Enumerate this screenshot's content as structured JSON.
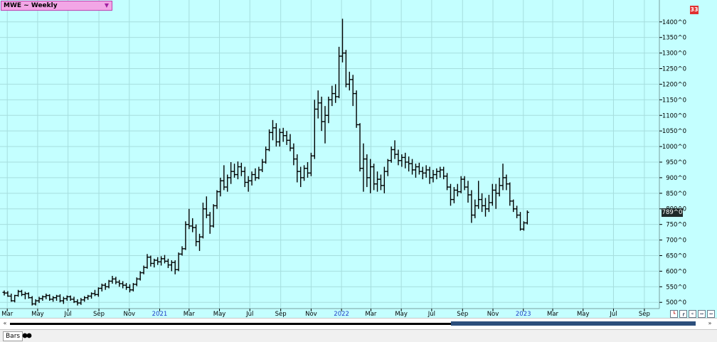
{
  "window": {
    "symbol_label": "MWE ~ Weekly",
    "dropdown_icon": "triangle-down-icon",
    "corner_button": "33",
    "status_label": "Bars",
    "status_icon": "link-circles-icon"
  },
  "colors": {
    "plot_bg": "#c4ffff",
    "grid": "#a6dede",
    "bars": "#000000",
    "year_label": "#1f3fc8",
    "month_label": "#000000",
    "price_tag_bg": "#1e2a2a"
  },
  "chart_data": {
    "type": "ohlc",
    "timeframe": "Weekly",
    "symbol": "MWE",
    "last_price_label": "789^0",
    "y_axis": {
      "scale": "linear",
      "ylim": [
        480,
        1420
      ],
      "ticks": [
        500,
        550,
        600,
        650,
        700,
        750,
        800,
        850,
        900,
        950,
        1000,
        1050,
        1100,
        1150,
        1200,
        1250,
        1300,
        1350,
        1400
      ],
      "tick_labels": [
        "500^0",
        "550^0",
        "600^0",
        "650^0",
        "700^0",
        "750^0",
        "800^0",
        "850^0",
        "900^0",
        "950^0",
        "1000^0",
        "1050^0",
        "1100^0",
        "1150^0",
        "1200^0",
        "1250^0",
        "1300^0",
        "1350^0",
        "1400^0"
      ]
    },
    "x_axis": {
      "first_week": "2020-02-24",
      "last_week": "2023-09-04",
      "tick_labels": [
        {
          "text": "Mar",
          "date": "2020-03-01",
          "kind": "month"
        },
        {
          "text": "May",
          "date": "2020-05-01",
          "kind": "month"
        },
        {
          "text": "Jul",
          "date": "2020-07-01",
          "kind": "month"
        },
        {
          "text": "Sep",
          "date": "2020-09-01",
          "kind": "month"
        },
        {
          "text": "Nov",
          "date": "2020-11-01",
          "kind": "month"
        },
        {
          "text": "2021",
          "date": "2021-01-01",
          "kind": "year"
        },
        {
          "text": "Mar",
          "date": "2021-03-01",
          "kind": "month"
        },
        {
          "text": "May",
          "date": "2021-05-01",
          "kind": "month"
        },
        {
          "text": "Jul",
          "date": "2021-07-01",
          "kind": "month"
        },
        {
          "text": "Sep",
          "date": "2021-09-01",
          "kind": "month"
        },
        {
          "text": "Nov",
          "date": "2021-11-01",
          "kind": "month"
        },
        {
          "text": "2022",
          "date": "2022-01-01",
          "kind": "year"
        },
        {
          "text": "Mar",
          "date": "2022-03-01",
          "kind": "month"
        },
        {
          "text": "May",
          "date": "2022-05-01",
          "kind": "month"
        },
        {
          "text": "Jul",
          "date": "2022-07-01",
          "kind": "month"
        },
        {
          "text": "Sep",
          "date": "2022-09-01",
          "kind": "month"
        },
        {
          "text": "Nov",
          "date": "2022-11-01",
          "kind": "month"
        },
        {
          "text": "2023",
          "date": "2023-01-01",
          "kind": "year"
        },
        {
          "text": "Mar",
          "date": "2023-03-01",
          "kind": "month"
        },
        {
          "text": "May",
          "date": "2023-05-01",
          "kind": "month"
        },
        {
          "text": "Jul",
          "date": "2023-07-01",
          "kind": "month"
        },
        {
          "text": "Sep",
          "date": "2023-09-01",
          "kind": "month"
        }
      ]
    },
    "grid": true,
    "bars": [
      [
        532,
        538,
        522,
        530
      ],
      [
        530,
        536,
        518,
        520
      ],
      [
        520,
        528,
        502,
        505
      ],
      [
        505,
        524,
        500,
        522
      ],
      [
        522,
        540,
        518,
        535
      ],
      [
        535,
        540,
        520,
        525
      ],
      [
        525,
        534,
        510,
        528
      ],
      [
        528,
        532,
        512,
        515
      ],
      [
        515,
        520,
        490,
        495
      ],
      [
        495,
        510,
        490,
        505
      ],
      [
        505,
        518,
        498,
        512
      ],
      [
        512,
        522,
        505,
        518
      ],
      [
        518,
        528,
        510,
        522
      ],
      [
        522,
        526,
        505,
        510
      ],
      [
        510,
        520,
        502,
        515
      ],
      [
        515,
        524,
        505,
        520
      ],
      [
        520,
        526,
        500,
        505
      ],
      [
        505,
        518,
        495,
        512
      ],
      [
        512,
        522,
        505,
        518
      ],
      [
        518,
        522,
        505,
        510
      ],
      [
        510,
        518,
        498,
        502
      ],
      [
        502,
        510,
        490,
        498
      ],
      [
        498,
        514,
        492,
        508
      ],
      [
        508,
        520,
        502,
        515
      ],
      [
        515,
        524,
        508,
        520
      ],
      [
        520,
        532,
        512,
        528
      ],
      [
        528,
        540,
        520,
        525
      ],
      [
        525,
        548,
        518,
        545
      ],
      [
        545,
        560,
        535,
        555
      ],
      [
        555,
        562,
        540,
        550
      ],
      [
        550,
        572,
        545,
        568
      ],
      [
        568,
        585,
        560,
        575
      ],
      [
        575,
        582,
        558,
        565
      ],
      [
        565,
        572,
        550,
        560
      ],
      [
        560,
        568,
        545,
        555
      ],
      [
        555,
        562,
        540,
        548
      ],
      [
        548,
        558,
        532,
        540
      ],
      [
        540,
        562,
        535,
        558
      ],
      [
        558,
        580,
        552,
        575
      ],
      [
        575,
        600,
        570,
        595
      ],
      [
        595,
        618,
        590,
        612
      ],
      [
        612,
        655,
        608,
        645
      ],
      [
        645,
        650,
        615,
        625
      ],
      [
        625,
        640,
        612,
        635
      ],
      [
        635,
        645,
        620,
        630
      ],
      [
        630,
        648,
        618,
        640
      ],
      [
        640,
        652,
        625,
        632
      ],
      [
        632,
        640,
        610,
        620
      ],
      [
        620,
        635,
        600,
        628
      ],
      [
        628,
        635,
        590,
        605
      ],
      [
        605,
        660,
        600,
        655
      ],
      [
        655,
        680,
        650,
        672
      ],
      [
        672,
        760,
        668,
        750
      ],
      [
        750,
        800,
        735,
        745
      ],
      [
        745,
        770,
        725,
        740
      ],
      [
        740,
        750,
        680,
        695
      ],
      [
        695,
        720,
        665,
        710
      ],
      [
        710,
        820,
        705,
        800
      ],
      [
        800,
        840,
        770,
        780
      ],
      [
        780,
        790,
        720,
        745
      ],
      [
        745,
        815,
        740,
        810
      ],
      [
        810,
        860,
        800,
        855
      ],
      [
        855,
        900,
        840,
        890
      ],
      [
        890,
        940,
        860,
        870
      ],
      [
        870,
        910,
        855,
        900
      ],
      [
        900,
        950,
        880,
        920
      ],
      [
        920,
        945,
        900,
        910
      ],
      [
        910,
        952,
        895,
        935
      ],
      [
        935,
        948,
        905,
        920
      ],
      [
        920,
        935,
        870,
        885
      ],
      [
        885,
        905,
        855,
        890
      ],
      [
        890,
        920,
        875,
        910
      ],
      [
        910,
        930,
        890,
        900
      ],
      [
        900,
        935,
        895,
        925
      ],
      [
        925,
        960,
        918,
        950
      ],
      [
        950,
        1000,
        945,
        990
      ],
      [
        990,
        1055,
        985,
        1045
      ],
      [
        1045,
        1085,
        1020,
        1060
      ],
      [
        1060,
        1075,
        1000,
        1015
      ],
      [
        1015,
        1058,
        1000,
        1045
      ],
      [
        1045,
        1060,
        1015,
        1035
      ],
      [
        1035,
        1050,
        1005,
        1020
      ],
      [
        1020,
        1040,
        985,
        995
      ],
      [
        995,
        1010,
        940,
        960
      ],
      [
        960,
        975,
        885,
        920
      ],
      [
        920,
        935,
        870,
        900
      ],
      [
        900,
        940,
        890,
        930
      ],
      [
        930,
        950,
        900,
        915
      ],
      [
        915,
        980,
        905,
        970
      ],
      [
        970,
        1150,
        960,
        1120
      ],
      [
        1120,
        1180,
        1090,
        1140
      ],
      [
        1140,
        1160,
        1050,
        1080
      ],
      [
        1080,
        1130,
        1010,
        1100
      ],
      [
        1100,
        1160,
        1075,
        1150
      ],
      [
        1150,
        1195,
        1130,
        1170
      ],
      [
        1170,
        1200,
        1140,
        1160
      ],
      [
        1160,
        1320,
        1155,
        1290
      ],
      [
        1290,
        1410,
        1270,
        1300
      ],
      [
        1300,
        1310,
        1190,
        1200
      ],
      [
        1200,
        1240,
        1180,
        1215
      ],
      [
        1215,
        1230,
        1130,
        1170
      ],
      [
        1170,
        1180,
        1060,
        1070
      ],
      [
        1070,
        1075,
        920,
        930
      ],
      [
        930,
        1010,
        855,
        960
      ],
      [
        960,
        975,
        870,
        900
      ],
      [
        900,
        960,
        850,
        935
      ],
      [
        935,
        945,
        860,
        880
      ],
      [
        880,
        920,
        855,
        895
      ],
      [
        895,
        910,
        860,
        875
      ],
      [
        875,
        935,
        850,
        920
      ],
      [
        920,
        960,
        905,
        955
      ],
      [
        955,
        1000,
        948,
        990
      ],
      [
        990,
        1020,
        960,
        975
      ],
      [
        975,
        990,
        940,
        955
      ],
      [
        955,
        975,
        935,
        965
      ],
      [
        965,
        980,
        930,
        950
      ],
      [
        950,
        968,
        920,
        945
      ],
      [
        945,
        960,
        910,
        925
      ],
      [
        925,
        945,
        900,
        935
      ],
      [
        935,
        948,
        910,
        920
      ],
      [
        920,
        935,
        895,
        915
      ],
      [
        915,
        940,
        900,
        925
      ],
      [
        925,
        935,
        880,
        900
      ],
      [
        900,
        925,
        885,
        910
      ],
      [
        910,
        930,
        895,
        920
      ],
      [
        920,
        935,
        900,
        925
      ],
      [
        925,
        935,
        895,
        905
      ],
      [
        905,
        915,
        860,
        870
      ],
      [
        870,
        880,
        810,
        830
      ],
      [
        830,
        870,
        818,
        860
      ],
      [
        860,
        880,
        840,
        855
      ],
      [
        855,
        905,
        850,
        895
      ],
      [
        895,
        905,
        860,
        870
      ],
      [
        870,
        890,
        820,
        845
      ],
      [
        845,
        860,
        755,
        780
      ],
      [
        780,
        830,
        770,
        810
      ],
      [
        810,
        890,
        800,
        830
      ],
      [
        830,
        850,
        790,
        810
      ],
      [
        810,
        835,
        775,
        800
      ],
      [
        800,
        845,
        790,
        820
      ],
      [
        820,
        880,
        810,
        860
      ],
      [
        860,
        880,
        800,
        850
      ],
      [
        850,
        900,
        840,
        875
      ],
      [
        875,
        945,
        860,
        900
      ],
      [
        900,
        910,
        860,
        880
      ],
      [
        880,
        885,
        810,
        825
      ],
      [
        825,
        830,
        790,
        800
      ],
      [
        800,
        810,
        770,
        780
      ],
      [
        780,
        790,
        730,
        735
      ],
      [
        735,
        760,
        730,
        755
      ],
      [
        755,
        795,
        750,
        789
      ]
    ]
  }
}
